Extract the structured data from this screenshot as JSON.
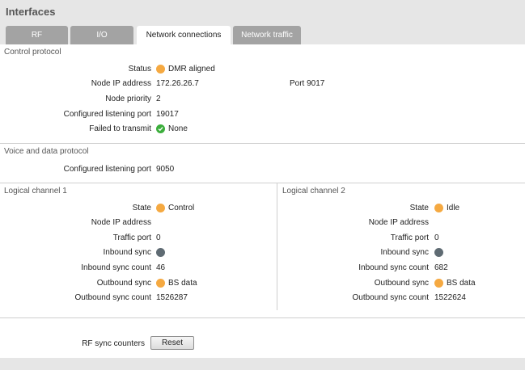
{
  "page": {
    "title": "Interfaces"
  },
  "tabs": [
    {
      "label": "RF"
    },
    {
      "label": "I/O"
    },
    {
      "label": "Network connections"
    },
    {
      "label": "Network traffic"
    }
  ],
  "control_protocol": {
    "title": "Control protocol",
    "status_label": "Status",
    "status_value": "DMR aligned",
    "node_ip_label": "Node IP address",
    "node_ip_value": "172.26.26.7",
    "port_text": "Port 9017",
    "node_priority_label": "Node priority",
    "node_priority_value": "2",
    "listening_port_label": "Configured listening port",
    "listening_port_value": "19017",
    "failed_label": "Failed to transmit",
    "failed_value": "None"
  },
  "voice_data_protocol": {
    "title": "Voice and data protocol",
    "listening_port_label": "Configured listening port",
    "listening_port_value": "9050"
  },
  "channels": [
    {
      "title": "Logical channel 1",
      "state_label": "State",
      "state_value": "Control",
      "node_ip_label": "Node IP address",
      "node_ip_value": "",
      "traffic_port_label": "Traffic port",
      "traffic_port_value": "0",
      "inbound_sync_label": "Inbound sync",
      "inbound_count_label": "Inbound sync count",
      "inbound_count_value": "46",
      "outbound_sync_label": "Outbound sync",
      "outbound_sync_value": "BS data",
      "outbound_count_label": "Outbound sync count",
      "outbound_count_value": "1526287"
    },
    {
      "title": "Logical channel 2",
      "state_label": "State",
      "state_value": "Idle",
      "node_ip_label": "Node IP address",
      "node_ip_value": "",
      "traffic_port_label": "Traffic port",
      "traffic_port_value": "0",
      "inbound_sync_label": "Inbound sync",
      "inbound_count_label": "Inbound sync count",
      "inbound_count_value": "682",
      "outbound_sync_label": "Outbound sync",
      "outbound_sync_value": "BS data",
      "outbound_count_label": "Outbound sync count",
      "outbound_count_value": "1522624"
    }
  ],
  "rf_sync": {
    "label": "RF sync counters",
    "reset_label": "Reset"
  },
  "colors": {
    "status_orange": "#f5a941",
    "status_grey": "#5f6b73",
    "status_green": "#3cae3c",
    "tab_inactive": "#a3a3a3"
  },
  "icons": {
    "status_dot": "status-dot-icon",
    "check": "check-circle-icon"
  }
}
